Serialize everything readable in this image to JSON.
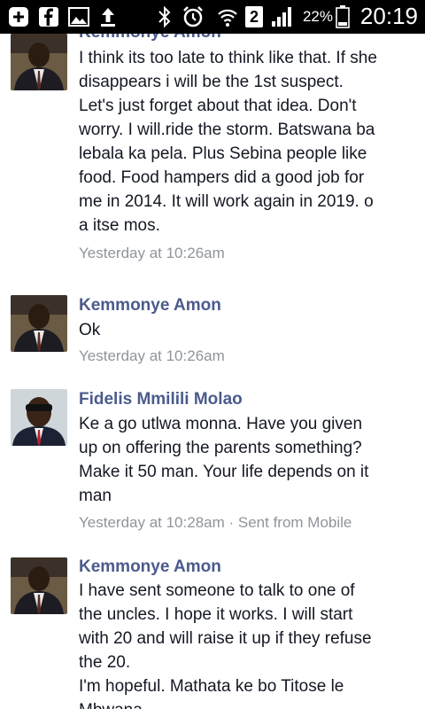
{
  "status_bar": {
    "battery_percent": "22%",
    "time": "20:19",
    "sim_badge": "2",
    "icons": [
      "add-icon",
      "facebook-icon",
      "image-icon",
      "upload-icon",
      "bluetooth-icon",
      "alarm-icon",
      "wifi-icon",
      "sim-2-icon",
      "signal-icon",
      "battery-icon"
    ]
  },
  "messages": [
    {
      "sender": "Kemmonye Amon",
      "text": "I think its too late to think like that. If she\ndisappears i will be the 1st suspect.\nLet's just forget about that idea. Don't\nworry. I will.ride the storm. Batswana ba\nlebala ka pela. Plus Sebina people like\nfood. Food hampers did a good job for\nme in 2014. It will work again in 2019. o\na itse mos.",
      "timestamp": "Yesterday at 10:26am"
    },
    {
      "sender": "Kemmonye Amon",
      "text": "Ok",
      "timestamp": "Yesterday at 10:26am"
    },
    {
      "sender": "Fidelis Mmilili Molao",
      "text": "Ke a go utlwa monna. Have you given\nup on offering the parents something?\nMake it 50 man. Your life depends on it\nman",
      "timestamp": "Yesterday at 10:28am · Sent from Mobile"
    },
    {
      "sender": "Kemmonye Amon",
      "text": "I have sent someone to talk to one of\nthe uncles. I hope it works. I will start\nwith 20 and will raise it up if they refuse\nthe 20.\nI'm hopeful. Mathata ke bo Titose le\nMbwana ...",
      "timestamp": ""
    }
  ]
}
